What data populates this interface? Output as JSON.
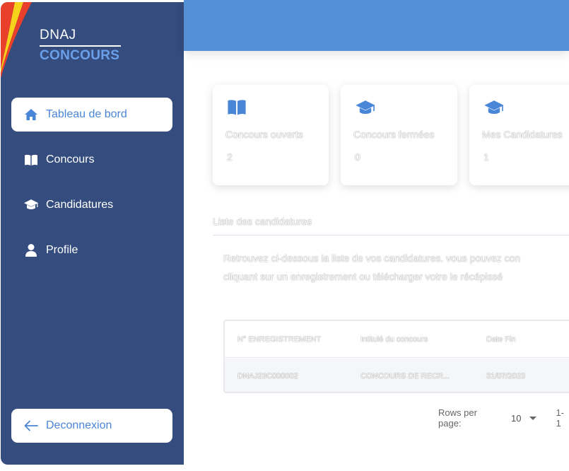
{
  "brand": {
    "top": "DNAJ",
    "bottom": "CONCOURS"
  },
  "sidebar": {
    "items": [
      {
        "label": "Tableau de bord",
        "icon": "home-icon",
        "active": true
      },
      {
        "label": "Concours",
        "icon": "book-icon",
        "active": false
      },
      {
        "label": "Candidatures",
        "icon": "graduation-cap-icon",
        "active": false
      },
      {
        "label": "Profile",
        "icon": "user-icon",
        "active": false
      }
    ],
    "logout": {
      "label": "Deconnexion",
      "icon": "arrow-left-icon"
    }
  },
  "cards": [
    {
      "label": "Concours ouverts",
      "value": "2",
      "icon": "book-icon"
    },
    {
      "label": "Concours fermées",
      "value": "0",
      "icon": "graduation-cap-icon"
    },
    {
      "label": "Mes Candidatures",
      "value": "1",
      "icon": "graduation-cap-icon"
    }
  ],
  "section": {
    "title": "Liste des candidatures",
    "desc_line1": "Retrouvez ci-dessous la liste de vos candidatures. vous pouvez con",
    "desc_line2": "cliquant sur un enregistrement ou télécharger votre le récépissé"
  },
  "table": {
    "headers": [
      "N° ENREGISTREMENT",
      "Intitulé du concours",
      "Date Fin"
    ],
    "rows": [
      [
        "DNAJ23C000002",
        "CONCOURS DE RECR...",
        "31/07/2023"
      ]
    ]
  },
  "pager": {
    "rows_per_page_label": "Rows per page:",
    "rows_per_page_value": "10",
    "range": "1-1"
  },
  "colors": {
    "sidebar": "#344c7e",
    "topbar": "#5590d6",
    "accent": "#4a86d8",
    "brand_accent": "#6aa0ea"
  }
}
